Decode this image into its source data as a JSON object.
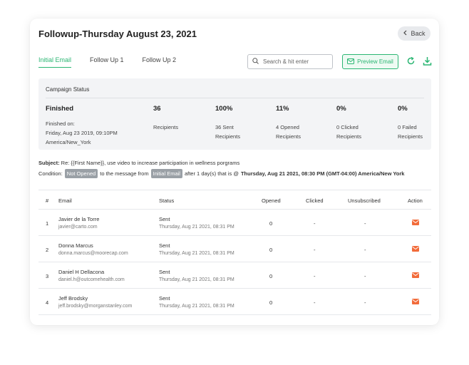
{
  "header": {
    "title": "Followup-Thursday August 23, 2021",
    "back_label": "Back"
  },
  "tabs": [
    {
      "label": "Initial Email",
      "active": true
    },
    {
      "label": "Follow Up 1",
      "active": false
    },
    {
      "label": "Follow Up 2",
      "active": false
    }
  ],
  "search": {
    "placeholder": "Search & hit enter"
  },
  "toolbar": {
    "preview_label": "Preview Email"
  },
  "campaign": {
    "title": "Campaign Status",
    "status": "Finished",
    "finished_on_label": "Finished on:",
    "finished_date": "Friday, Aug 23 2019, 09:10PM",
    "timezone": "America/New_York",
    "stats": [
      {
        "value": "36",
        "line1": "Recipients",
        "line2": ""
      },
      {
        "value": "100%",
        "line1": "36 Sent",
        "line2": "Recipients"
      },
      {
        "value": "11%",
        "line1": "4 Opened",
        "line2": "Recipients"
      },
      {
        "value": "0%",
        "line1": "0 Clicked",
        "line2": "Recipients"
      },
      {
        "value": "0%",
        "line1": "0 Failed",
        "line2": "Recipients"
      }
    ]
  },
  "subject": {
    "label": "Subject:",
    "text": " Re: {{First Name}}, use video to increase participation in wellness porgrams"
  },
  "condition": {
    "label": "Condition:",
    "pill1": "Not Opened",
    "mid": "to the message from",
    "pill2": "Initial Email",
    "after": "after 1 day(s) that is @",
    "datetime": "Thursday, Aug 21 2021, 08:30 PM (GMT-04:00) America/New York"
  },
  "table": {
    "headers": [
      "#",
      "Email",
      "Status",
      "Opened",
      "Clicked",
      "Unsubscribed",
      "Action"
    ],
    "rows": [
      {
        "num": "1",
        "name": "Javier de la Torre",
        "email": "javier@carto.com",
        "status": "Sent",
        "status_time": "Thursday, Aug 21 2021, 08:31 PM",
        "opened": "0",
        "clicked": "-",
        "unsubscribed": "-"
      },
      {
        "num": "2",
        "name": "Donna Marcus",
        "email": "donna.marcus@moorecap.com",
        "status": "Sent",
        "status_time": "Thursday, Aug 21 2021, 08:31 PM",
        "opened": "0",
        "clicked": "-",
        "unsubscribed": "-"
      },
      {
        "num": "3",
        "name": "Daniel H Dellacona",
        "email": "daniel.h@outcomehealth.com",
        "status": "Sent",
        "status_time": "Thursday, Aug 21 2021, 08:31 PM",
        "opened": "0",
        "clicked": "-",
        "unsubscribed": "-"
      },
      {
        "num": "4",
        "name": "Jeff Brodsky",
        "email": "jeff.brodsky@morganstanley.com",
        "status": "Sent",
        "status_time": "Thursday, Aug 21 2021, 08:31 PM",
        "opened": "0",
        "clicked": "-",
        "unsubscribed": "-"
      }
    ]
  },
  "colors": {
    "accent": "#2bb673",
    "action_icon": "#f26b3a",
    "pill": "#9aa0a6"
  },
  "icons": {
    "back": "chevron-left-icon",
    "search": "search-icon",
    "preview": "mail-icon",
    "refresh": "refresh-icon",
    "download": "download-icon",
    "action": "mail-icon"
  }
}
